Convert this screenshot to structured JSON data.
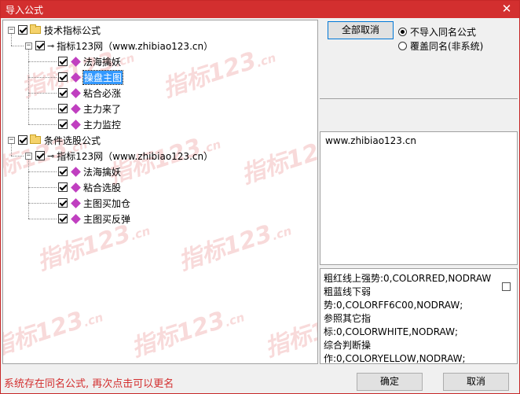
{
  "window": {
    "title": "导入公式"
  },
  "tree": [
    {
      "label": "技术指标公式",
      "level": 0,
      "kind": "folder",
      "checked": true,
      "expanded": true
    },
    {
      "label": "指标123网（www.zhibiao123.cn）",
      "level": 1,
      "kind": "group",
      "checked": true,
      "expanded": true
    },
    {
      "label": "法海擒妖",
      "level": 2,
      "kind": "formula",
      "checked": true
    },
    {
      "label": "操盘主图",
      "level": 2,
      "kind": "formula",
      "checked": true,
      "selected": true
    },
    {
      "label": "粘合必涨",
      "level": 2,
      "kind": "formula",
      "checked": true
    },
    {
      "label": "主力来了",
      "level": 2,
      "kind": "formula",
      "checked": true
    },
    {
      "label": "主力监控",
      "level": 2,
      "kind": "formula",
      "checked": true
    },
    {
      "label": "条件选股公式",
      "level": 0,
      "kind": "folder",
      "checked": true,
      "expanded": true
    },
    {
      "label": "指标123网（www.zhibiao123.cn）",
      "level": 1,
      "kind": "group",
      "checked": true,
      "expanded": true
    },
    {
      "label": "法海擒妖",
      "level": 2,
      "kind": "formula",
      "checked": true
    },
    {
      "label": "粘合选股",
      "level": 2,
      "kind": "formula",
      "checked": true
    },
    {
      "label": "主图买加仓",
      "level": 2,
      "kind": "formula",
      "checked": true
    },
    {
      "label": "主图买反弹",
      "level": 2,
      "kind": "formula",
      "checked": true
    }
  ],
  "watermark": {
    "text": "指标123",
    "suffix": ".cn"
  },
  "controls": {
    "cancel_all_label": "全部取消",
    "radio_no_import": "不导入同名公式",
    "radio_overwrite": "覆盖同名(非系统)",
    "selected_radio": "no_import"
  },
  "description": {
    "url": "www.zhibiao123.cn"
  },
  "code_lines": [
    "粗红线上强势:0,COLORRED,NODRAW;",
    "粗蓝线下弱",
    "势:0,COLORFF6C00,NODRAW;",
    "参照其它指",
    "标:0,COLORWHITE,NODRAW;",
    "综合判断操",
    "作:0,COLORYELLOW,NODRAW;"
  ],
  "status": {
    "message": "系统存在同名公式, 再次点击可以更名"
  },
  "buttons": {
    "ok_label": "确定",
    "cancel_label": "取消"
  }
}
